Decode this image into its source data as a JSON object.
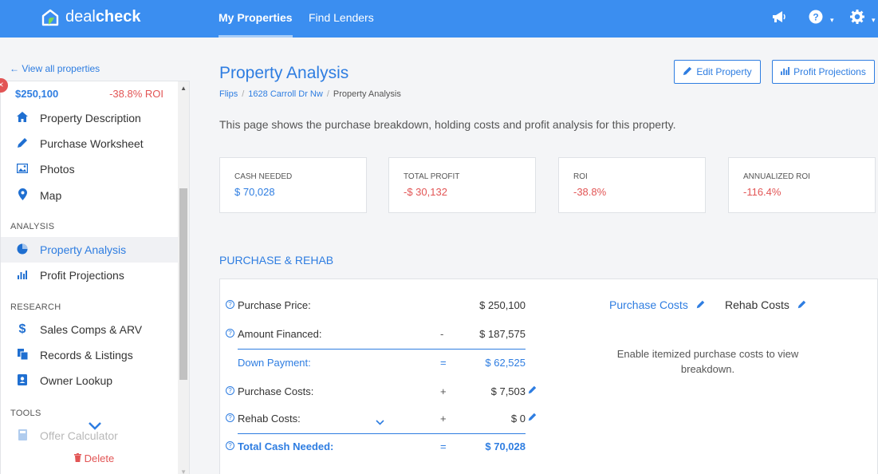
{
  "app": {
    "logo_text_light": "deal",
    "logo_text_bold": "check"
  },
  "nav": {
    "tabs": [
      {
        "label": "My Properties",
        "active": true
      },
      {
        "label": "Find Lenders",
        "active": false
      }
    ],
    "icons": [
      "megaphone-icon",
      "help-icon",
      "settings-icon"
    ]
  },
  "sidebar": {
    "view_all": "← View all properties",
    "price": "$250,100",
    "roi": "-38.8% ROI",
    "items_top": [
      {
        "label": "Property Description",
        "icon": "home-icon"
      },
      {
        "label": "Purchase Worksheet",
        "icon": "pencil-icon"
      },
      {
        "label": "Photos",
        "icon": "image-icon"
      },
      {
        "label": "Map",
        "icon": "map-pin-icon"
      }
    ],
    "section_analysis": "ANALYSIS",
    "items_analysis": [
      {
        "label": "Property Analysis",
        "icon": "pie-chart-icon",
        "active": true
      },
      {
        "label": "Profit Projections",
        "icon": "bar-chart-icon"
      }
    ],
    "section_research": "RESEARCH",
    "items_research": [
      {
        "label": "Sales Comps & ARV",
        "icon": "dollar-icon"
      },
      {
        "label": "Records & Listings",
        "icon": "documents-icon"
      },
      {
        "label": "Owner Lookup",
        "icon": "contact-icon"
      }
    ],
    "section_tools": "TOOLS",
    "items_tools": [
      {
        "label": "Offer Calculator",
        "icon": "calculator-icon"
      }
    ],
    "delete": "Delete"
  },
  "main": {
    "title": "Property Analysis",
    "breadcrumb": [
      "Flips",
      "1628 Carroll Dr Nw",
      "Property Analysis"
    ],
    "edit_button": "Edit Property",
    "projections_button": "Profit Projections",
    "description": "This page shows the purchase breakdown, holding costs and profit analysis for this property.",
    "metrics": [
      {
        "label": "CASH NEEDED",
        "value": "$ 70,028",
        "tone": "positive"
      },
      {
        "label": "TOTAL PROFIT",
        "value": "-$ 30,132",
        "tone": "negative"
      },
      {
        "label": "ROI",
        "value": "-38.8%",
        "tone": "negative"
      },
      {
        "label": "ANNUALIZED ROI",
        "value": "-116.4%",
        "tone": "negative"
      }
    ],
    "section_title": "PURCHASE & REHAB",
    "rows": [
      {
        "label": "Purchase Price:",
        "op": "",
        "amount": "$ 250,100"
      },
      {
        "label": "Amount Financed:",
        "op": "-",
        "amount": "$ 187,575"
      },
      {
        "label": "Down Payment:",
        "op": "=",
        "amount": "$ 62,525"
      },
      {
        "label": "Purchase Costs:",
        "op": "+",
        "amount": "$ 7,503"
      },
      {
        "label": "Rehab Costs:",
        "op": "+",
        "amount": "$ 0"
      },
      {
        "label": "Total Cash Needed:",
        "op": "=",
        "amount": "$ 70,028"
      }
    ],
    "purchase_costs_link": "Purchase Costs",
    "rehab_costs_link": "Rehab Costs",
    "empty_message": "Enable itemized purchase costs to view breakdown."
  }
}
